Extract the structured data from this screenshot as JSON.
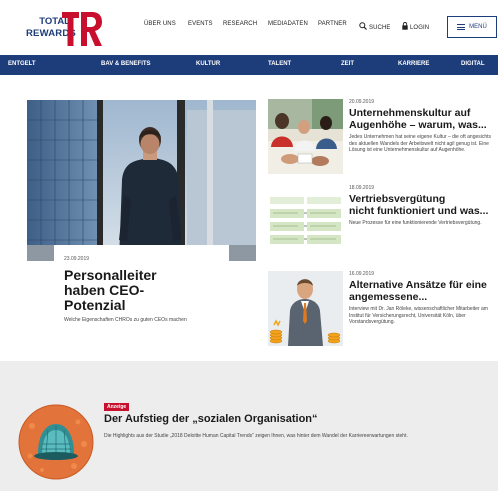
{
  "header": {
    "logo_line1": "TOTAL",
    "logo_line2": "REWARDS",
    "logo_mark": "TR",
    "nav": [
      "ÜBER UNS",
      "EVENTS",
      "RESEARCH",
      "MEDIADATEN",
      "PARTNER"
    ],
    "search_label": "SUCHE",
    "login_label": "LOGIN",
    "menu_label": "MENÜ"
  },
  "categories": [
    "ENTGELT",
    "BAV & BENEFITS",
    "KULTUR",
    "TALENT",
    "ZEIT",
    "KARRIERE",
    "DIGITAL"
  ],
  "featured": {
    "date": "23.09.2019",
    "title": "Personalleiter haben CEO-Potenzial",
    "subtitle": "Welche Eigenschaften CHROs zu guten CEOs machen"
  },
  "articles": [
    {
      "date": "20.09.2019",
      "title_line1": "Unternehmenskultur auf",
      "title_line2": "Augenhöhe – warum, was...",
      "desc": "Jedes Unternehmen hat seine eigene Kultur – die oft angesichts des aktuellen Wandels der Arbeitswelt nicht agil genug ist. Eine Lösung ist eine Unternehmenskultur auf Augenhöhe."
    },
    {
      "date": "18.09.2019",
      "title_line1": "Vertriebsvergütung",
      "title_line2": "nicht funktioniert und was...",
      "desc": "Neue Prozesse für eine funktionierende Vertriebsvergütung."
    },
    {
      "date": "16.09.2019",
      "title_line1": "Alternative Ansätze für eine",
      "title_line2": "angemessene...",
      "desc": "Interview mit Dr. Jan Röleke, wissenschaftlicher Mitarbeiter am Institut für Versicherungsrecht, Universität Köln, über Vorstandsvergütung."
    }
  ],
  "ad": {
    "badge": "Anzeige",
    "title": "Der Aufstieg der „sozialen Organisation“",
    "desc": "Die Highlights aus der Studie „2018 Deloitte Human Capital Trends“ zeigen Ihnen, was hinter dem Wandel der Karriereerwartungen steht."
  },
  "colors": {
    "brand_blue": "#1d3c7a",
    "brand_red": "#c8102e",
    "ad_bg": "#ededed"
  }
}
